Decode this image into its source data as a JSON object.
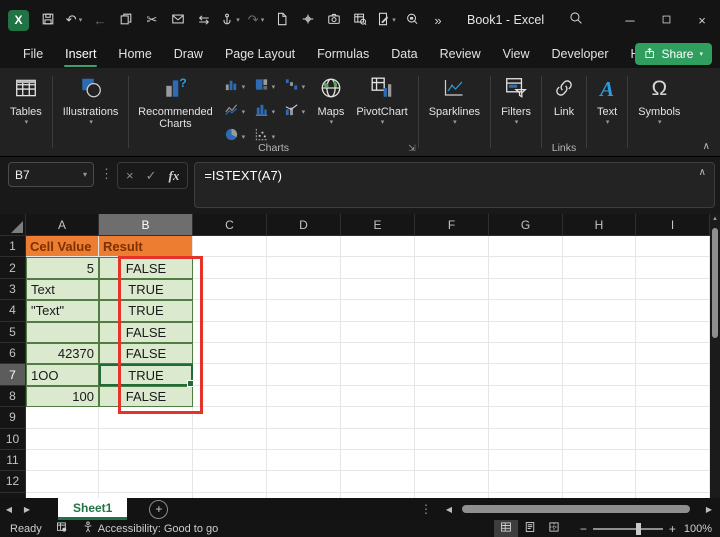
{
  "titlebar": {
    "title": "Book1 - Excel",
    "qat": [
      {
        "icon": "save-icon"
      },
      {
        "icon": "undo-icon",
        "chevron": true
      },
      {
        "icon": "back-icon",
        "disabled": true
      },
      {
        "icon": "copy-icon"
      },
      {
        "icon": "cut-icon"
      },
      {
        "icon": "email-icon"
      },
      {
        "icon": "find-replace-icon"
      },
      {
        "icon": "touch-mode-icon",
        "chevron": true
      },
      {
        "icon": "redo-icon",
        "chevron": true,
        "disabled": true
      },
      {
        "icon": "new-document-icon"
      },
      {
        "icon": "center-anchor-icon"
      },
      {
        "icon": "camera-icon"
      },
      {
        "icon": "sheet-view-icon"
      },
      {
        "icon": "edit-document-icon",
        "chevron": true
      },
      {
        "icon": "protect-search-icon"
      },
      {
        "icon": "more-commands-icon"
      }
    ]
  },
  "tabs": {
    "items": [
      "File",
      "Insert",
      "Home",
      "Draw",
      "Page Layout",
      "Formulas",
      "Data",
      "Review",
      "View",
      "Developer",
      "Help"
    ],
    "active": "Insert",
    "share_label": "Share"
  },
  "ribbon": {
    "tables_label": "Tables",
    "illustrations_label": "Illustrations",
    "recommended_charts_label": "Recommended Charts",
    "charts_group_label": "Charts",
    "chart_type_icons": [
      "column-chart-icon",
      "treemap-chart-icon",
      "waterfall-chart-icon",
      "line-chart-icon",
      "histogram-chart-icon",
      "combo-chart-icon",
      "pie-chart-icon",
      "scatter-chart-icon"
    ],
    "maps_label": "Maps",
    "pivotchart_label": "PivotChart",
    "sparklines_label": "Sparklines",
    "filters_label": "Filters",
    "link_label": "Link",
    "links_group_label": "Links",
    "text_label": "Text",
    "symbols_label": "Symbols"
  },
  "formula_bar": {
    "name_box": "B7",
    "formula": "=ISTEXT(A7)"
  },
  "grid": {
    "columns": [
      "A",
      "B",
      "C",
      "D",
      "E",
      "F",
      "G",
      "H",
      "I"
    ],
    "selected_column": "B",
    "selected_row": 7,
    "active_cell": "B7",
    "visible_rows": 13,
    "rows": [
      {
        "row": 1,
        "A": {
          "v": "Cell Value",
          "fill": "orange",
          "align": "left"
        },
        "B": {
          "v": "Result",
          "fill": "orange",
          "align": "left"
        }
      },
      {
        "row": 2,
        "A": {
          "v": "5",
          "fill": "green",
          "align": "right"
        },
        "B": {
          "v": "FALSE",
          "fill": "green",
          "align": "center"
        }
      },
      {
        "row": 3,
        "A": {
          "v": "Text",
          "fill": "green",
          "align": "left"
        },
        "B": {
          "v": "TRUE",
          "fill": "green",
          "align": "center"
        }
      },
      {
        "row": 4,
        "A": {
          "v": "\"Text\"",
          "fill": "green",
          "align": "left"
        },
        "B": {
          "v": "TRUE",
          "fill": "green",
          "align": "center"
        }
      },
      {
        "row": 5,
        "A": {
          "v": "",
          "fill": "green",
          "align": "left"
        },
        "B": {
          "v": "FALSE",
          "fill": "green",
          "align": "center"
        }
      },
      {
        "row": 6,
        "A": {
          "v": "42370",
          "fill": "green",
          "align": "right"
        },
        "B": {
          "v": "FALSE",
          "fill": "green",
          "align": "center"
        }
      },
      {
        "row": 7,
        "A": {
          "v": "1OO",
          "fill": "green",
          "align": "left"
        },
        "B": {
          "v": "TRUE",
          "fill": "green",
          "align": "center"
        }
      },
      {
        "row": 8,
        "A": {
          "v": "100",
          "fill": "green",
          "align": "right"
        },
        "B": {
          "v": "FALSE",
          "fill": "green",
          "align": "center"
        }
      }
    ],
    "annotation": {
      "type": "red-box",
      "range": "B2:B8"
    }
  },
  "sheet_bar": {
    "active_tab": "Sheet1"
  },
  "status_bar": {
    "ready_label": "Ready",
    "accessibility_label": "Accessibility: Good to go",
    "zoom_level": "100%"
  },
  "colors": {
    "excel_green": "#217346",
    "share_button_green": "#2f9e5f",
    "header_fill_orange": "#ED7D31",
    "header_text_brown": "#7F3000",
    "cell_fill_green": "#DBE9CE",
    "cell_border_green": "#4f7d42",
    "annotation_red": "#E63329",
    "active_cell_border_green": "#1E6B3C",
    "icon_accent_blue": "#2d6cb5"
  }
}
